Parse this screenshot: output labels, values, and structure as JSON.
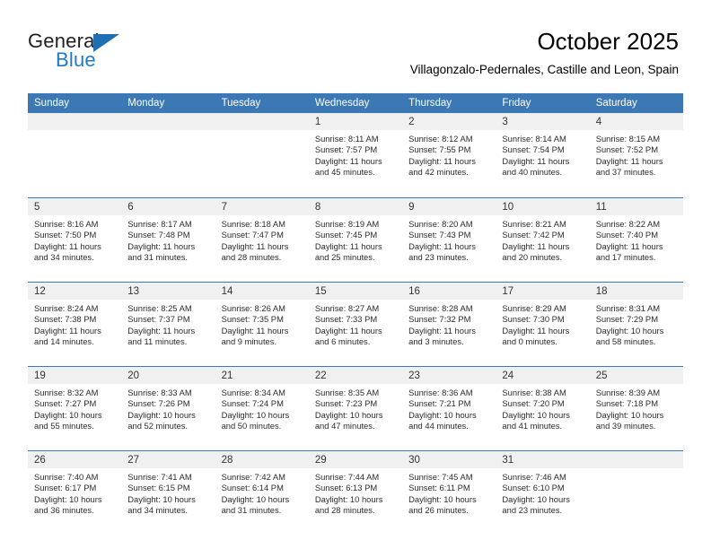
{
  "brand": {
    "name_part1": "General",
    "name_part2": "Blue",
    "accent_color": "#1f7ac4",
    "triangle_color": "#1f6fb5"
  },
  "header": {
    "month_title": "October 2025",
    "location": "Villagonzalo-Pedernales, Castille and Leon, Spain"
  },
  "calendar": {
    "header_color": "#3c78b4",
    "daynum_band_color": "#f0f0f0",
    "weekday_headers": [
      "Sunday",
      "Monday",
      "Tuesday",
      "Wednesday",
      "Thursday",
      "Friday",
      "Saturday"
    ],
    "weeks": [
      [
        {
          "day": "",
          "sunrise": "",
          "sunset": "",
          "daylight_line1": "",
          "daylight_line2": ""
        },
        {
          "day": "",
          "sunrise": "",
          "sunset": "",
          "daylight_line1": "",
          "daylight_line2": ""
        },
        {
          "day": "",
          "sunrise": "",
          "sunset": "",
          "daylight_line1": "",
          "daylight_line2": ""
        },
        {
          "day": "1",
          "sunrise": "Sunrise: 8:11 AM",
          "sunset": "Sunset: 7:57 PM",
          "daylight_line1": "Daylight: 11 hours",
          "daylight_line2": "and 45 minutes."
        },
        {
          "day": "2",
          "sunrise": "Sunrise: 8:12 AM",
          "sunset": "Sunset: 7:55 PM",
          "daylight_line1": "Daylight: 11 hours",
          "daylight_line2": "and 42 minutes."
        },
        {
          "day": "3",
          "sunrise": "Sunrise: 8:14 AM",
          "sunset": "Sunset: 7:54 PM",
          "daylight_line1": "Daylight: 11 hours",
          "daylight_line2": "and 40 minutes."
        },
        {
          "day": "4",
          "sunrise": "Sunrise: 8:15 AM",
          "sunset": "Sunset: 7:52 PM",
          "daylight_line1": "Daylight: 11 hours",
          "daylight_line2": "and 37 minutes."
        }
      ],
      [
        {
          "day": "5",
          "sunrise": "Sunrise: 8:16 AM",
          "sunset": "Sunset: 7:50 PM",
          "daylight_line1": "Daylight: 11 hours",
          "daylight_line2": "and 34 minutes."
        },
        {
          "day": "6",
          "sunrise": "Sunrise: 8:17 AM",
          "sunset": "Sunset: 7:48 PM",
          "daylight_line1": "Daylight: 11 hours",
          "daylight_line2": "and 31 minutes."
        },
        {
          "day": "7",
          "sunrise": "Sunrise: 8:18 AM",
          "sunset": "Sunset: 7:47 PM",
          "daylight_line1": "Daylight: 11 hours",
          "daylight_line2": "and 28 minutes."
        },
        {
          "day": "8",
          "sunrise": "Sunrise: 8:19 AM",
          "sunset": "Sunset: 7:45 PM",
          "daylight_line1": "Daylight: 11 hours",
          "daylight_line2": "and 25 minutes."
        },
        {
          "day": "9",
          "sunrise": "Sunrise: 8:20 AM",
          "sunset": "Sunset: 7:43 PM",
          "daylight_line1": "Daylight: 11 hours",
          "daylight_line2": "and 23 minutes."
        },
        {
          "day": "10",
          "sunrise": "Sunrise: 8:21 AM",
          "sunset": "Sunset: 7:42 PM",
          "daylight_line1": "Daylight: 11 hours",
          "daylight_line2": "and 20 minutes."
        },
        {
          "day": "11",
          "sunrise": "Sunrise: 8:22 AM",
          "sunset": "Sunset: 7:40 PM",
          "daylight_line1": "Daylight: 11 hours",
          "daylight_line2": "and 17 minutes."
        }
      ],
      [
        {
          "day": "12",
          "sunrise": "Sunrise: 8:24 AM",
          "sunset": "Sunset: 7:38 PM",
          "daylight_line1": "Daylight: 11 hours",
          "daylight_line2": "and 14 minutes."
        },
        {
          "day": "13",
          "sunrise": "Sunrise: 8:25 AM",
          "sunset": "Sunset: 7:37 PM",
          "daylight_line1": "Daylight: 11 hours",
          "daylight_line2": "and 11 minutes."
        },
        {
          "day": "14",
          "sunrise": "Sunrise: 8:26 AM",
          "sunset": "Sunset: 7:35 PM",
          "daylight_line1": "Daylight: 11 hours",
          "daylight_line2": "and 9 minutes."
        },
        {
          "day": "15",
          "sunrise": "Sunrise: 8:27 AM",
          "sunset": "Sunset: 7:33 PM",
          "daylight_line1": "Daylight: 11 hours",
          "daylight_line2": "and 6 minutes."
        },
        {
          "day": "16",
          "sunrise": "Sunrise: 8:28 AM",
          "sunset": "Sunset: 7:32 PM",
          "daylight_line1": "Daylight: 11 hours",
          "daylight_line2": "and 3 minutes."
        },
        {
          "day": "17",
          "sunrise": "Sunrise: 8:29 AM",
          "sunset": "Sunset: 7:30 PM",
          "daylight_line1": "Daylight: 11 hours",
          "daylight_line2": "and 0 minutes."
        },
        {
          "day": "18",
          "sunrise": "Sunrise: 8:31 AM",
          "sunset": "Sunset: 7:29 PM",
          "daylight_line1": "Daylight: 10 hours",
          "daylight_line2": "and 58 minutes."
        }
      ],
      [
        {
          "day": "19",
          "sunrise": "Sunrise: 8:32 AM",
          "sunset": "Sunset: 7:27 PM",
          "daylight_line1": "Daylight: 10 hours",
          "daylight_line2": "and 55 minutes."
        },
        {
          "day": "20",
          "sunrise": "Sunrise: 8:33 AM",
          "sunset": "Sunset: 7:26 PM",
          "daylight_line1": "Daylight: 10 hours",
          "daylight_line2": "and 52 minutes."
        },
        {
          "day": "21",
          "sunrise": "Sunrise: 8:34 AM",
          "sunset": "Sunset: 7:24 PM",
          "daylight_line1": "Daylight: 10 hours",
          "daylight_line2": "and 50 minutes."
        },
        {
          "day": "22",
          "sunrise": "Sunrise: 8:35 AM",
          "sunset": "Sunset: 7:23 PM",
          "daylight_line1": "Daylight: 10 hours",
          "daylight_line2": "and 47 minutes."
        },
        {
          "day": "23",
          "sunrise": "Sunrise: 8:36 AM",
          "sunset": "Sunset: 7:21 PM",
          "daylight_line1": "Daylight: 10 hours",
          "daylight_line2": "and 44 minutes."
        },
        {
          "day": "24",
          "sunrise": "Sunrise: 8:38 AM",
          "sunset": "Sunset: 7:20 PM",
          "daylight_line1": "Daylight: 10 hours",
          "daylight_line2": "and 41 minutes."
        },
        {
          "day": "25",
          "sunrise": "Sunrise: 8:39 AM",
          "sunset": "Sunset: 7:18 PM",
          "daylight_line1": "Daylight: 10 hours",
          "daylight_line2": "and 39 minutes."
        }
      ],
      [
        {
          "day": "26",
          "sunrise": "Sunrise: 7:40 AM",
          "sunset": "Sunset: 6:17 PM",
          "daylight_line1": "Daylight: 10 hours",
          "daylight_line2": "and 36 minutes."
        },
        {
          "day": "27",
          "sunrise": "Sunrise: 7:41 AM",
          "sunset": "Sunset: 6:15 PM",
          "daylight_line1": "Daylight: 10 hours",
          "daylight_line2": "and 34 minutes."
        },
        {
          "day": "28",
          "sunrise": "Sunrise: 7:42 AM",
          "sunset": "Sunset: 6:14 PM",
          "daylight_line1": "Daylight: 10 hours",
          "daylight_line2": "and 31 minutes."
        },
        {
          "day": "29",
          "sunrise": "Sunrise: 7:44 AM",
          "sunset": "Sunset: 6:13 PM",
          "daylight_line1": "Daylight: 10 hours",
          "daylight_line2": "and 28 minutes."
        },
        {
          "day": "30",
          "sunrise": "Sunrise: 7:45 AM",
          "sunset": "Sunset: 6:11 PM",
          "daylight_line1": "Daylight: 10 hours",
          "daylight_line2": "and 26 minutes."
        },
        {
          "day": "31",
          "sunrise": "Sunrise: 7:46 AM",
          "sunset": "Sunset: 6:10 PM",
          "daylight_line1": "Daylight: 10 hours",
          "daylight_line2": "and 23 minutes."
        },
        {
          "day": "",
          "sunrise": "",
          "sunset": "",
          "daylight_line1": "",
          "daylight_line2": ""
        }
      ]
    ]
  }
}
